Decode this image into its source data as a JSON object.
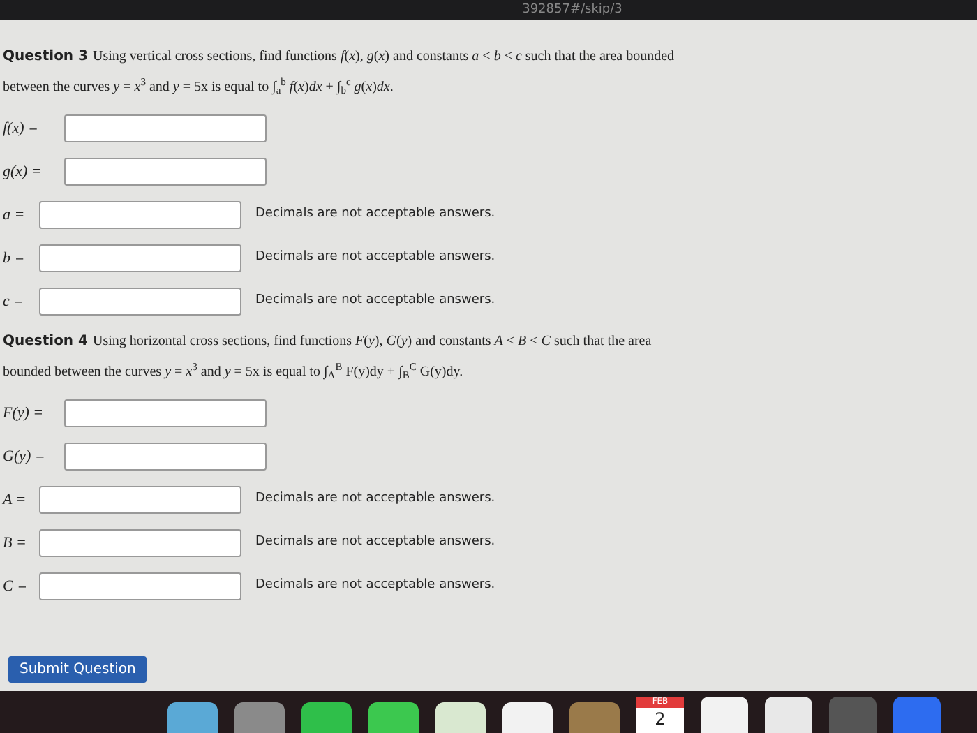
{
  "url_fragment": "392857#/skip/3",
  "questions": [
    {
      "number": "Question 3",
      "text": "Using vertical cross sections, find functions *f*(*x*), *g*(*x*) and constants *a* < *b* < *c* such that the area bounded between the curves *y* = *x*$^{3}$ and *y* = 5x is equal to ∫$_{a}$$^{b}$ *f*(*x*)*dx* + ∫$_{b}$$^{c}$ *g*(*x*)*dx*.",
      "fields": [
        {
          "label": "f(x) ="
        },
        {
          "label": "g(x) ="
        },
        {
          "label": "a =",
          "note": "Decimals are not acceptable answers."
        },
        {
          "label": "b =",
          "note": "Decimals are not acceptable answers."
        },
        {
          "label": "c =",
          "note": "Decimals are not acceptable answers."
        }
      ]
    },
    {
      "number": "Question 4",
      "text": "Using horizontal cross sections, find functions *F*(*y*), *G*(*y*) and constants *A* < *B* < *C* such that the area bounded between the curves *y* = *x*$^{3}$ and *y* = 5x is equal to ∫$_{A}$$^{B}$ F(y)dy + ∫$_{B}$$^{C}$ G(y)dy.",
      "fields": [
        {
          "label": "F(y) ="
        },
        {
          "label": "G(y) ="
        },
        {
          "label": "A =",
          "note": "Decimals are not acceptable answers."
        },
        {
          "label": "B =",
          "note": "Decimals are not acceptable answers."
        },
        {
          "label": "C =",
          "note": "Decimals are not acceptable answers."
        }
      ]
    }
  ],
  "submit": "Submit Question",
  "dock": {
    "calendar_month": "FEB",
    "calendar_day": "2"
  }
}
